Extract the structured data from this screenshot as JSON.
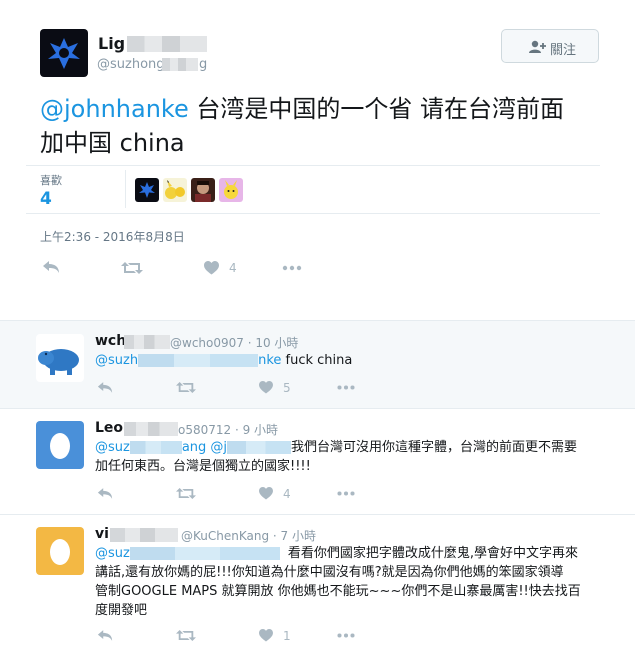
{
  "main_tweet": {
    "name": "Lig",
    "handle": "@suzhong",
    "handle_tail": "g",
    "follow_label": "關注",
    "mention": "@johnhanke",
    "text_line1": " 台湾是中国的一个省 请在台湾前面",
    "text_line2": "加中国 china",
    "likes_label": "喜歡",
    "likes_count": "4",
    "timestamp": "上午2:36 - 2016年8月8日",
    "like_count": "4"
  },
  "replies": [
    {
      "name": "wch",
      "handle_time": "@wcho0907 · 10 小時",
      "mention_start": "@suzh",
      "mention_end": "nke",
      "text": " fuck china",
      "like_count": "5"
    },
    {
      "name": "Leo",
      "handle_time": "o580712 · 9 小時",
      "mention_start": "@suz",
      "mention_mid": "ang @j",
      "text_line1": "我們台灣可沒用你這種字體，台灣的前面更不需要",
      "text_line2": "加任何東西。台灣是個獨立的國家!!!!",
      "like_count": "4"
    },
    {
      "name": "vi",
      "handle_time": "@KuChenKang · 7 小時",
      "mention_start": "@suz",
      "text_line1": "看看你們國家把字體改成什麼鬼,學會好中文字再來",
      "text_line2": "講話,還有放你媽的屁!!!你知道為什麼中國沒有嗎?就是因為你們他媽的笨國家領導",
      "text_line3": "管制GOOGLE MAPS 就算開放 你他媽也不能玩~~~你們不是山寨最厲害!!快去找百",
      "text_line4": "度開發吧",
      "like_count": "1"
    }
  ],
  "colors": {
    "link": "#1b95e0",
    "muted": "#8899a6",
    "reply_bg": "#f5f8fa",
    "icon": "#aab8c2"
  }
}
